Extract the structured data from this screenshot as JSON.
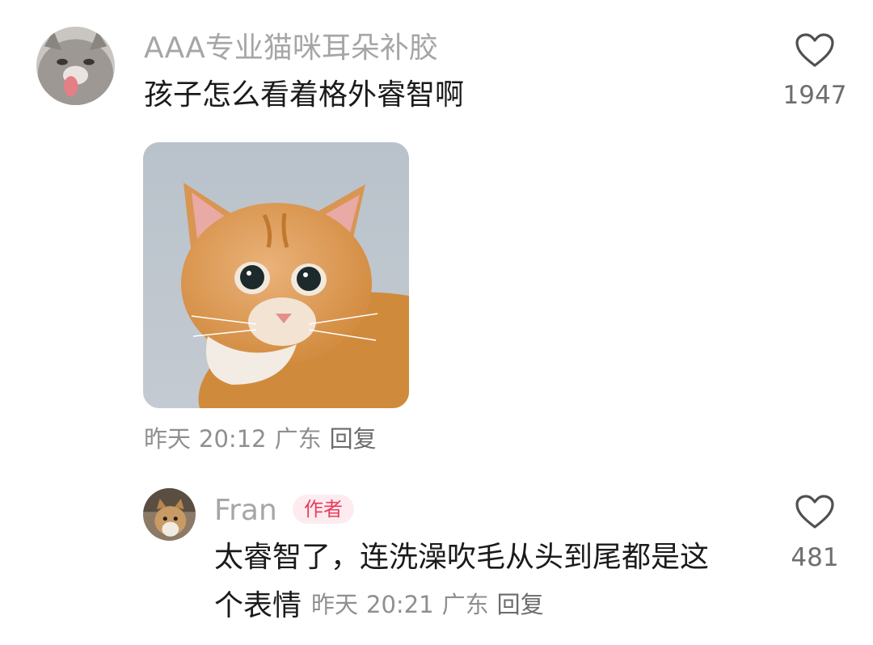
{
  "comment": {
    "username": "AAA专业猫咪耳朵补胶",
    "text": "孩子怎么看着格外睿智啊",
    "likes": "1947",
    "date": "昨天",
    "time": "20:12",
    "location": "广东",
    "reply_label": "回复",
    "image_icon": "orange-cat-photo"
  },
  "reply": {
    "username": "Fran",
    "badge": "作者",
    "text_line1": "太睿智了，连洗澡吹毛从头到尾都是这",
    "text_line2": "个表情",
    "likes": "481",
    "date": "昨天",
    "time": "20:21",
    "location": "广东",
    "reply_label": "回复"
  },
  "colors": {
    "username": "#a6a6a6",
    "text": "#1a1a1a",
    "meta": "#8f8f8f",
    "badge_text": "#ea3d5d",
    "badge_bg": "#fdecef"
  }
}
